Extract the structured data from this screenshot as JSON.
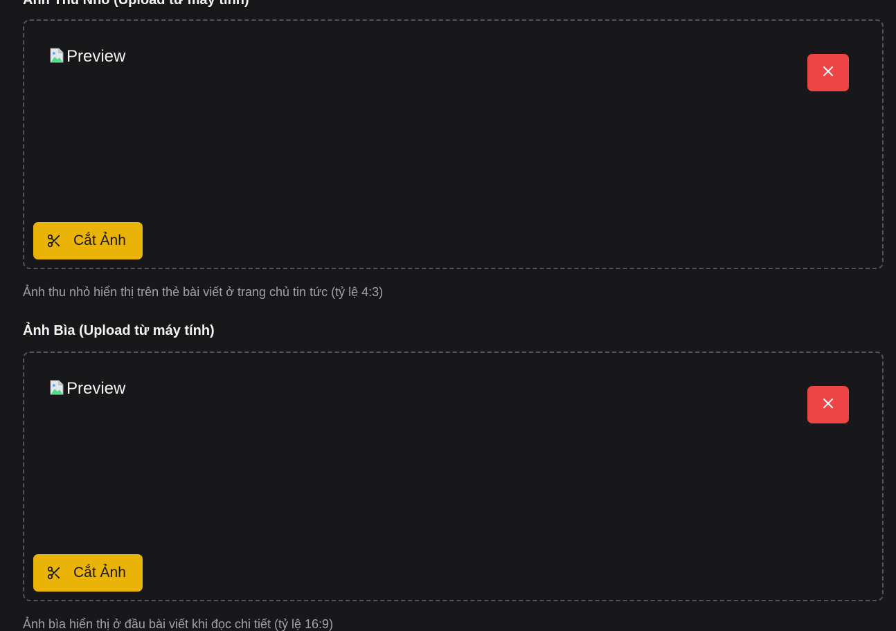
{
  "thumbnail": {
    "label": "Ảnh Thu Nhỏ (Upload từ máy tính)",
    "preview_alt": "Preview",
    "crop_label": "Cắt Ảnh",
    "help": "Ảnh thu nhỏ hiển thị trên thẻ bài viết ở trang chủ tin tức (tỷ lệ 4:3)"
  },
  "cover": {
    "label": "Ảnh Bìa (Upload từ máy tính)",
    "preview_alt": "Preview",
    "crop_label": "Cắt Ảnh",
    "help": "Ảnh bìa hiển thị ở đầu bài viết khi đọc chi tiết (tỷ lệ 16:9)"
  },
  "colors": {
    "background": "#18181b",
    "remove": "#ef4444",
    "crop": "#eab308",
    "help_text": "#a1a1aa"
  },
  "icons": {
    "remove": "close-icon",
    "crop": "scissors-icon",
    "preview": "broken-image-icon"
  }
}
